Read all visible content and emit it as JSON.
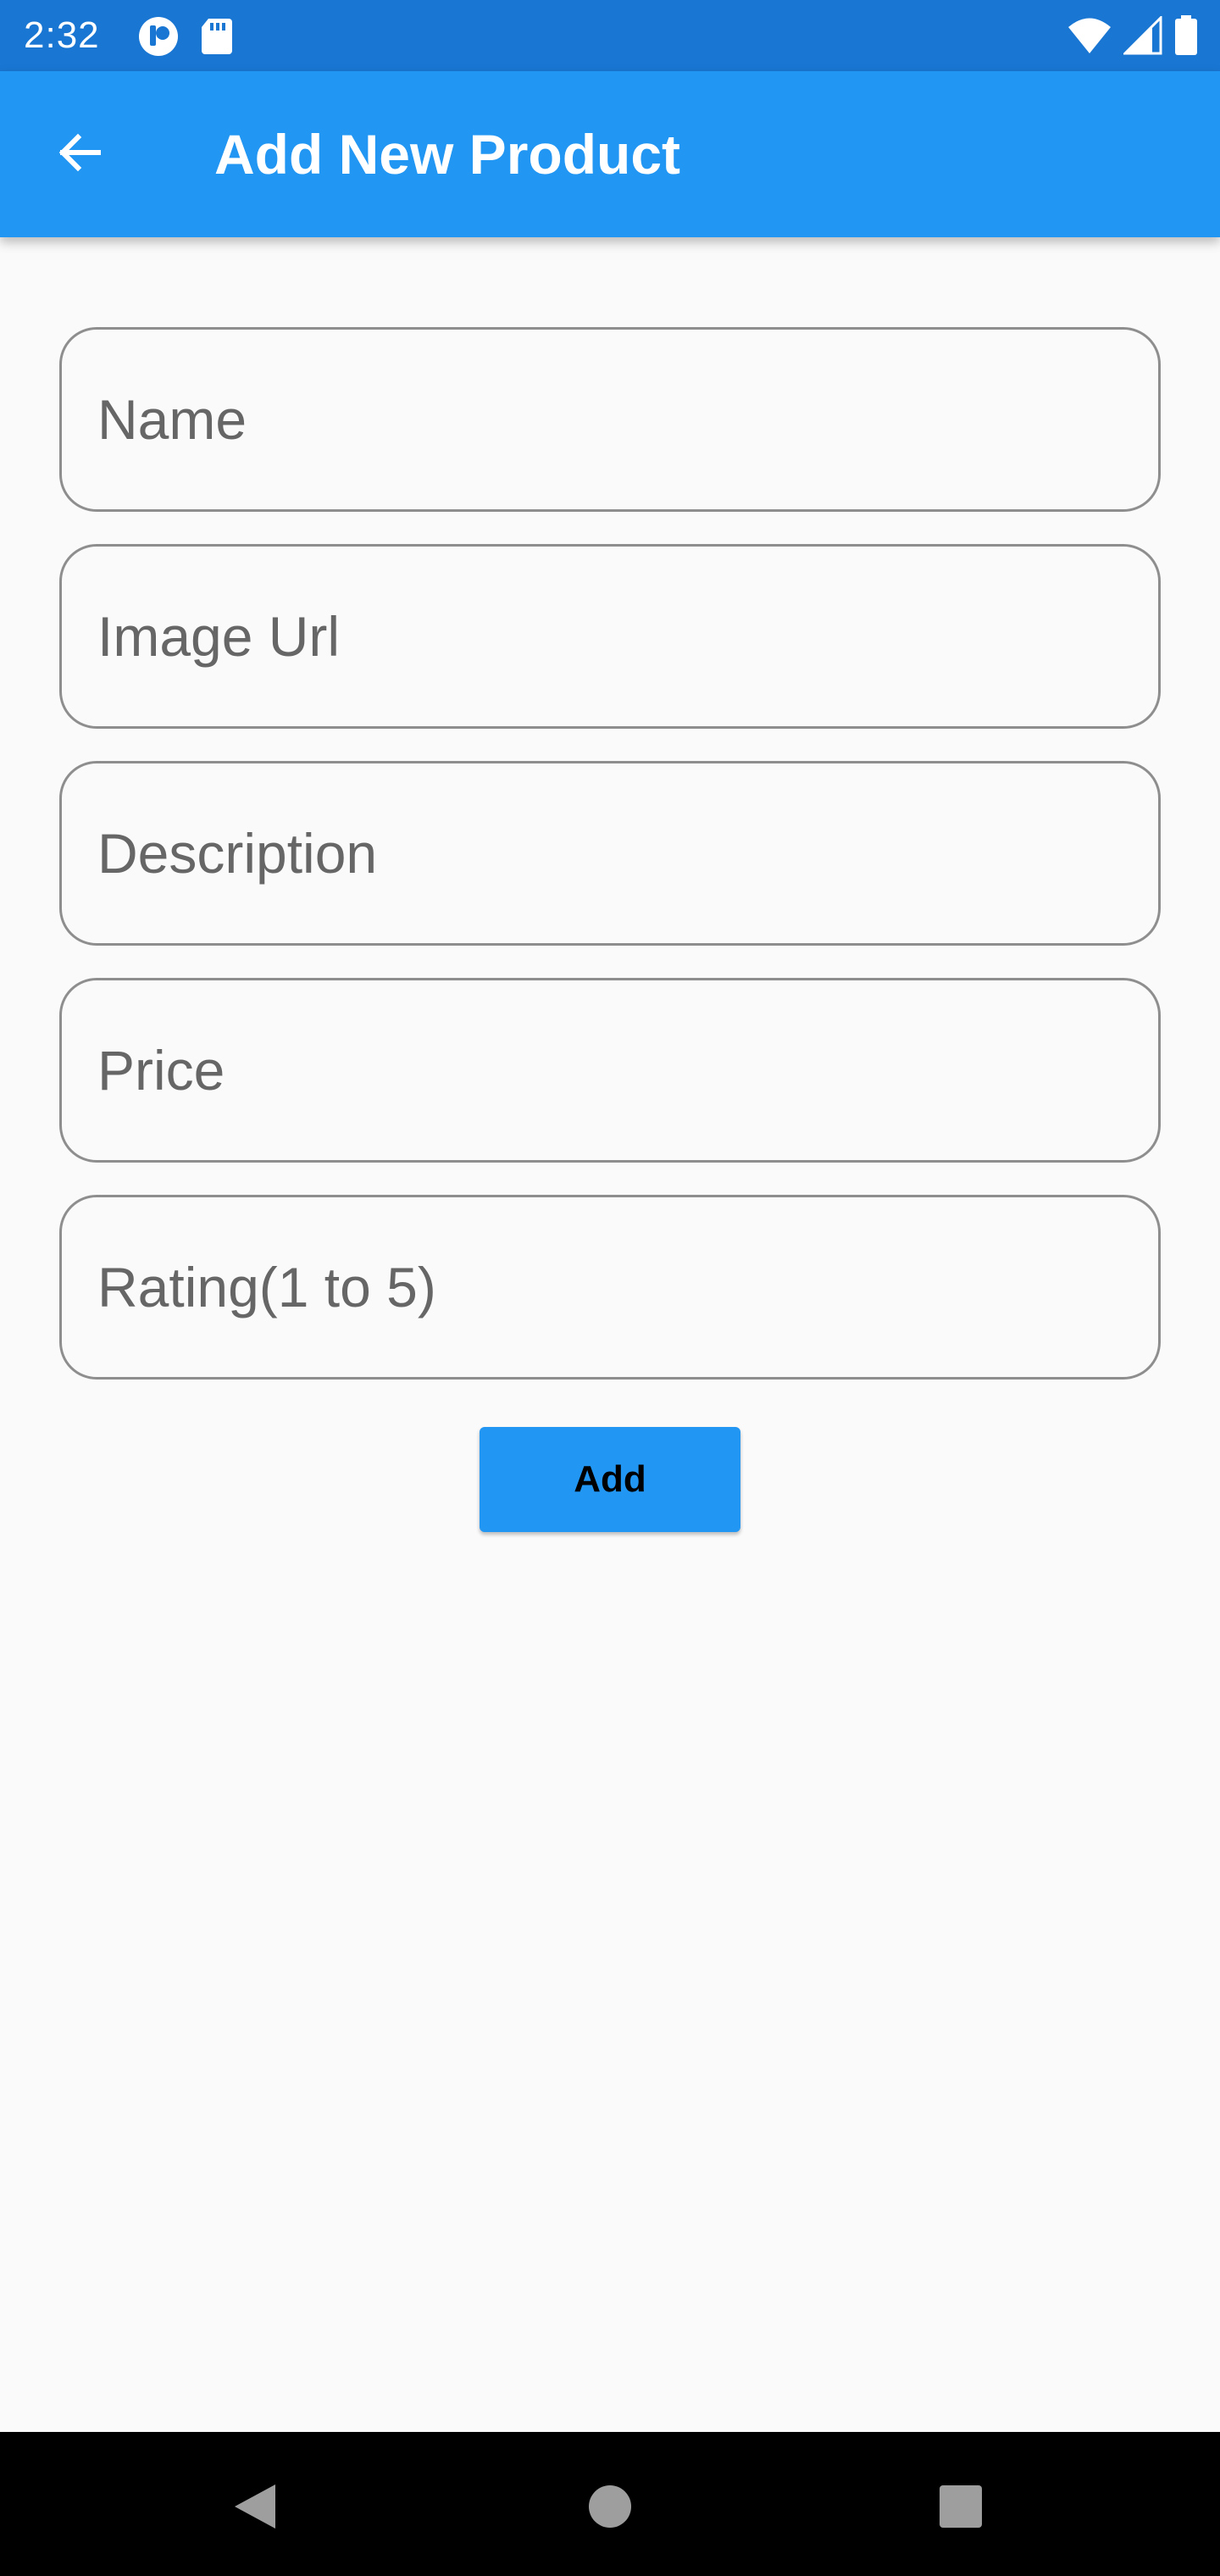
{
  "status_bar": {
    "time": "2:32",
    "left_icons": [
      "app-notification-icon",
      "sd-card-icon"
    ],
    "right_icons": [
      "wifi-icon",
      "cell-signal-icon",
      "battery-icon"
    ]
  },
  "app_bar": {
    "back_icon": "arrow-back-icon",
    "title": "Add New Product",
    "color": "#2196f3"
  },
  "form": {
    "fields": [
      {
        "placeholder": "Name",
        "value": ""
      },
      {
        "placeholder": "Image Url",
        "value": ""
      },
      {
        "placeholder": "Description",
        "value": ""
      },
      {
        "placeholder": "Price",
        "value": ""
      },
      {
        "placeholder": "Rating(1 to 5)",
        "value": ""
      }
    ],
    "submit_label": "Add"
  },
  "nav_bar": {
    "buttons": [
      "back-triangle-icon",
      "home-circle-icon",
      "recents-square-icon"
    ]
  },
  "colors": {
    "status_bar": "#1976d2",
    "accent": "#2196f3",
    "background": "#fafafa"
  }
}
